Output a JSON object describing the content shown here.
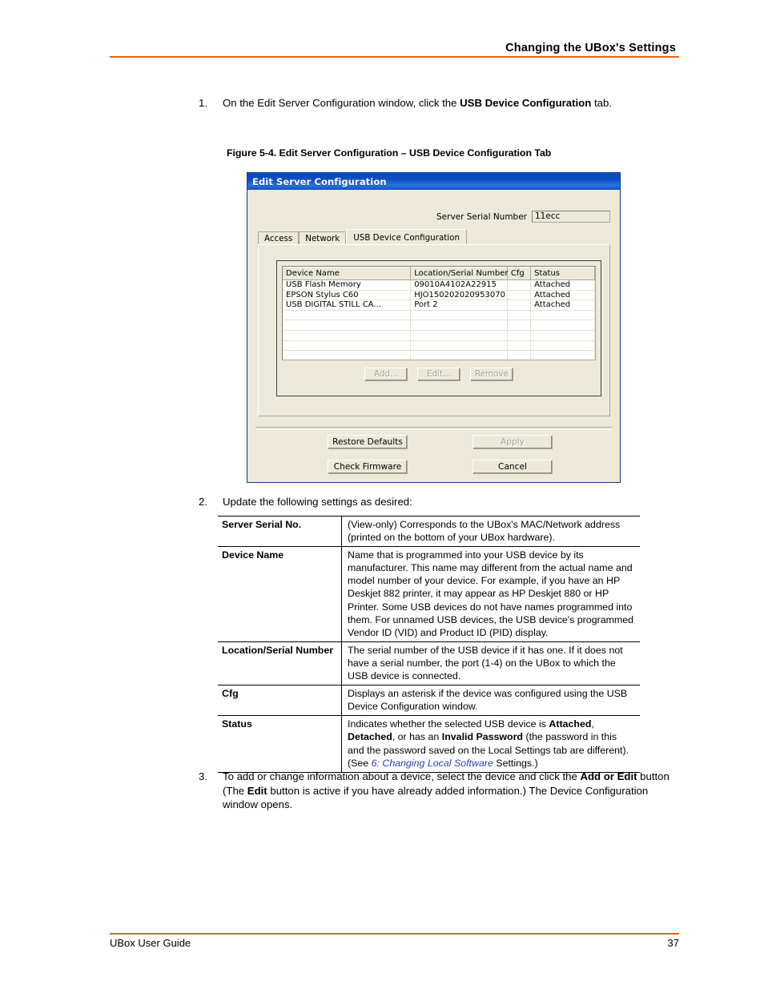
{
  "page": {
    "header_title": "Changing the UBox's Settings",
    "footer_left": "UBox User Guide",
    "footer_page_number": "37",
    "accent_color": "#E8610A"
  },
  "steps": {
    "one": {
      "number": "1.",
      "text_before": "On the Edit Server Configuration window, click the ",
      "bold": "USB Device Configuration",
      "text_after": " tab."
    },
    "two": {
      "number": "2.",
      "text": "Update the following settings as desired:"
    },
    "three": {
      "number": "3.",
      "part1": "To add or change information about a device, select the device and click the ",
      "bold1": "Add or Edit",
      "part2": " button (The ",
      "bold2": "Edit",
      "part3": " button is active if you have already added information.) The Device Configuration window opens."
    }
  },
  "figure": {
    "caption": "Figure 5-4. Edit Server Configuration – USB Device Configuration Tab"
  },
  "dialog": {
    "title": "Edit Server Configuration",
    "serial_label": "Server Serial Number",
    "serial_value": "11ecc",
    "tabs": [
      {
        "label": "Access",
        "selected": false
      },
      {
        "label": "Network",
        "selected": false
      },
      {
        "label": "USB Device Configuration",
        "selected": true
      }
    ],
    "table": {
      "columns": [
        "Device Name",
        "Location/Serial Number",
        "Cfg",
        "Status"
      ],
      "rows": [
        {
          "name": "USB Flash Memory",
          "location": "09010A4102A22915",
          "cfg": "",
          "status": "Attached"
        },
        {
          "name": "EPSON Stylus C60",
          "location": "HJO150202020953070",
          "cfg": "",
          "status": "Attached"
        },
        {
          "name": "USB DIGITAL STILL CA...",
          "location": "Port 2",
          "cfg": "",
          "status": "Attached"
        }
      ],
      "empty_rows": 5
    },
    "item_buttons": [
      {
        "label": "Add...",
        "enabled": false
      },
      {
        "label": "Edit...",
        "enabled": false
      },
      {
        "label": "Remove",
        "enabled": false
      }
    ],
    "action_buttons": {
      "restore_defaults": "Restore Defaults",
      "check_firmware": "Check Firmware",
      "apply": "Apply",
      "cancel": "Cancel"
    }
  },
  "settings_table": {
    "rows": [
      {
        "term": "Server Serial No.",
        "desc": "(View-only) Corresponds to the UBox's MAC/Network address (printed on the bottom of your UBox hardware)."
      },
      {
        "term": "Device Name",
        "desc": "Name that is programmed into your USB device by its manufacturer. This name may different from the actual name and model number of your device. For example, if you have an HP Deskjet 882 printer, it may appear as HP Deskjet 880 or HP Printer. Some USB devices do not have names programmed into them. For unnamed USB devices, the USB device's programmed Vendor ID (VID) and Product ID (PID) display."
      },
      {
        "term": "Location/Serial Number",
        "desc": "The serial number of the USB device if it has one. If it does not have a serial number, the port (1-4) on the UBox to which the USB device is connected."
      },
      {
        "term": "Cfg",
        "desc": "Displays an asterisk if the device was configured using the USB Device Configuration window."
      },
      {
        "term": "Status",
        "desc_part1": "Indicates whether the selected USB device is ",
        "desc_bold1": "Attached",
        "desc_part2": ", ",
        "desc_bold2": "Detached",
        "desc_part3": ", or has an ",
        "desc_bold3": "Invalid Password",
        "desc_part4": " (the password in this and the password saved on the Local Settings tab are different). (See ",
        "desc_link": "6: Changing Local Software",
        "desc_part5": " Settings.)"
      }
    ]
  }
}
